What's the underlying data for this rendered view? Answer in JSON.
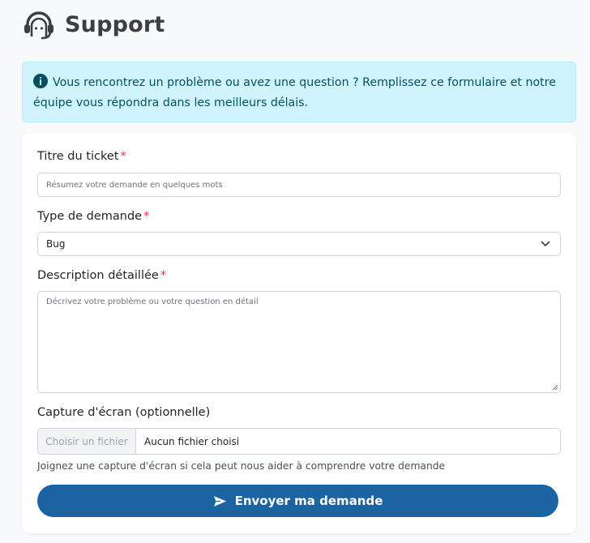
{
  "header": {
    "title": "Support",
    "icon": "headset-icon"
  },
  "alert": {
    "icon": "info-icon",
    "message": "Vous rencontrez un problème ou avez une question ? Remplissez ce formulaire et notre équipe vous répondra dans les meilleurs délais.",
    "colors": {
      "background": "#cff4fc",
      "text": "#055160"
    }
  },
  "form": {
    "required_marker": "*",
    "title_field": {
      "label": "Titre du ticket",
      "placeholder": "Résumez votre demande en quelques mots",
      "value": ""
    },
    "type_field": {
      "label": "Type de demande",
      "selected": "Bug"
    },
    "description_field": {
      "label": "Description détaillée",
      "placeholder": "Décrivez votre problème ou votre question en détail",
      "value": ""
    },
    "screenshot_field": {
      "label": "Capture d'écran (optionnelle)",
      "button_label": "Choisir un fichier",
      "file_status": "Aucun fichier choisi",
      "help": "Joignez une capture d'écran si cela peut nous aider à comprendre votre demande"
    },
    "submit": {
      "label": "Envoyer ma demande",
      "icon": "send-icon",
      "color": "#1b63a1"
    }
  }
}
